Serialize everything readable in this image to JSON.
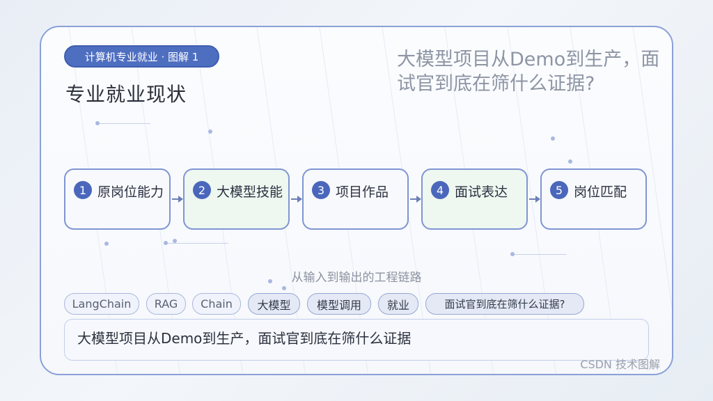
{
  "header": {
    "tag": "计算机专业就业 · 图解 1",
    "page_title": "专业就业现状",
    "headline": "大模型项目从Demo到生产，面试官到底在筛什么证据?"
  },
  "flow": {
    "steps": [
      {
        "num": "1",
        "label": "原岗位能力"
      },
      {
        "num": "2",
        "label": "大模型技能"
      },
      {
        "num": "3",
        "label": "项目作品"
      },
      {
        "num": "4",
        "label": "面试表达"
      },
      {
        "num": "5",
        "label": "岗位匹配"
      }
    ],
    "caption": "从输入到输出的工程链路"
  },
  "tags": [
    "LangChain",
    "RAG",
    "Chain",
    "大模型",
    "模型调用",
    "就业",
    "面试官到底在筛什么证据?"
  ],
  "summary": "大模型项目从Demo到生产，面试官到底在筛什么证据",
  "footer": "CSDN 技术图解",
  "colors": {
    "accent": "#4e6ec0",
    "border": "#8aa0d8",
    "green_fill": "#eef7f0"
  }
}
